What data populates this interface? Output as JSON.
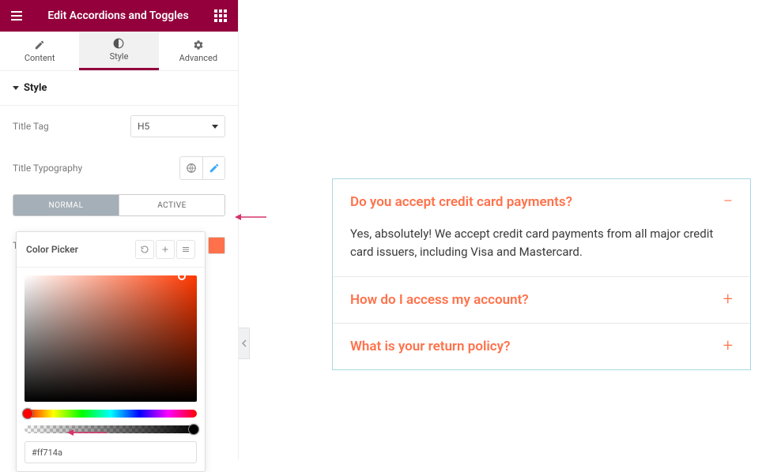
{
  "header": {
    "title": "Edit Accordions and Toggles"
  },
  "tabs": [
    {
      "label": "Content"
    },
    {
      "label": "Style"
    },
    {
      "label": "Advanced"
    }
  ],
  "section": {
    "title": "Style"
  },
  "controls": {
    "title_tag": {
      "label": "Title Tag",
      "value": "H5"
    },
    "title_typography": {
      "label": "Title Typography"
    },
    "state_tabs": {
      "normal": "NORMAL",
      "active": "ACTIVE"
    },
    "title_color": {
      "label": "Title Color",
      "value": "#ff714a"
    }
  },
  "color_picker": {
    "title": "Color Picker",
    "hex": "#ff714a"
  },
  "preview": {
    "accent": "#ff714a",
    "items": [
      {
        "title": "Do you accept credit card payments?",
        "expanded": true,
        "body": "Yes, absolutely! We accept credit card payments from all major credit card issuers, including Visa and Mastercard."
      },
      {
        "title": "How do I access my account?",
        "expanded": false
      },
      {
        "title": "What is your return policy?",
        "expanded": false
      }
    ]
  }
}
